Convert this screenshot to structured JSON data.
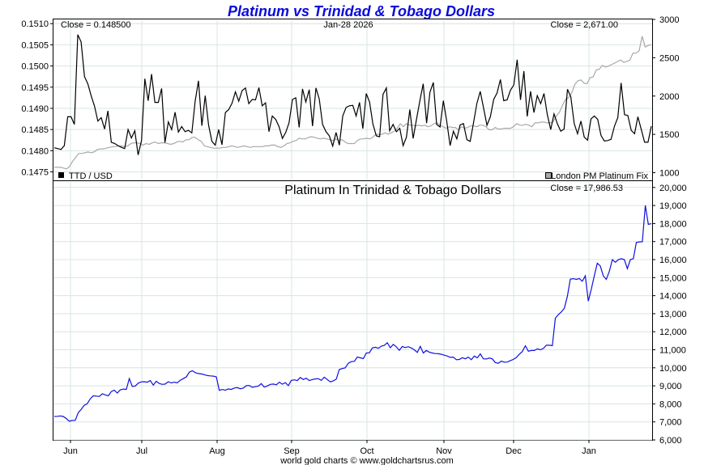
{
  "chart_data": {
    "type": "line",
    "title": "Platinum vs Trinidad & Tobago Dollars",
    "date": "Jan-28  2026",
    "footer": "world gold charts © www.goldchartsrus.com",
    "colors": {
      "title": "#0a0adc",
      "ttd": "#000000",
      "platinum_usd": "#a8a8a8",
      "platinum_ttd": "#1010e0",
      "grid": "#d8e4e4"
    },
    "x_ticks": [
      "Jun",
      "Jul",
      "Aug",
      "Sep",
      "Oct",
      "Nov",
      "Dec",
      "Jan"
    ],
    "top_panel": {
      "close_left": "Close = 0.148500",
      "close_right": "Close = 2,671.00",
      "left_ticks": [
        "0.1510",
        "0.1505",
        "0.1500",
        "0.1495",
        "0.1490",
        "0.1485",
        "0.1480",
        "0.1475"
      ],
      "right_ticks": [
        "3000",
        "2500",
        "2000",
        "1500",
        "1000"
      ],
      "ylim_left": [
        0.1473,
        0.1511
      ],
      "ylim_right": [
        900,
        3000
      ],
      "legend_left": "TTD / USD",
      "legend_right": "London PM Platinum Fix",
      "series": [
        {
          "name": "TTD / USD",
          "axis": "left",
          "values": [
            0.14807,
            0.14805,
            0.14803,
            0.14812,
            0.1488,
            0.1488,
            0.14862,
            0.15074,
            0.15057,
            0.14975,
            0.14958,
            0.1493,
            0.14905,
            0.1487,
            0.14878,
            0.14851,
            0.14894,
            0.1482,
            0.14817,
            0.14812,
            0.14808,
            0.14805,
            0.1485,
            0.1483,
            0.14847,
            0.1479,
            0.14824,
            0.1497,
            0.14918,
            0.14981,
            0.14914,
            0.14914,
            0.14947,
            0.14819,
            0.14868,
            0.1485,
            0.14891,
            0.14844,
            0.14857,
            0.14845,
            0.14848,
            0.14842,
            0.14917,
            0.14965,
            0.14859,
            0.1493,
            0.1486,
            0.14822,
            0.14813,
            0.1485,
            0.14814,
            0.1489,
            0.14897,
            0.14912,
            0.14939,
            0.14917,
            0.14942,
            0.14948,
            0.14911,
            0.14921,
            0.1492,
            0.14949,
            0.14906,
            0.14913,
            0.14845,
            0.14882,
            0.14874,
            0.14857,
            0.14829,
            0.14843,
            0.14866,
            0.14921,
            0.14925,
            0.14855,
            0.14946,
            0.14915,
            0.14944,
            0.14858,
            0.14948,
            0.14922,
            0.14862,
            0.14845,
            0.14835,
            0.14811,
            0.14843,
            0.14813,
            0.14882,
            0.14902,
            0.14906,
            0.14907,
            0.14882,
            0.14914,
            0.14852,
            0.14935,
            0.14915,
            0.14863,
            0.14835,
            0.14833,
            0.14933,
            0.14948,
            0.14847,
            0.14862,
            0.14845,
            0.14853,
            0.14812,
            0.14832,
            0.14897,
            0.14829,
            0.14875,
            0.14918,
            0.14958,
            0.14865,
            0.14938,
            0.14961,
            0.14862,
            0.14856,
            0.14918,
            0.1487,
            0.14812,
            0.14846,
            0.14828,
            0.14861,
            0.14864,
            0.14826,
            0.14822,
            0.14867,
            0.14912,
            0.1494,
            0.149,
            0.1486,
            0.1488,
            0.14921,
            0.14936,
            0.14968,
            0.14918,
            0.1492,
            0.14943,
            0.14955,
            0.15015,
            0.1492,
            0.14988,
            0.14881,
            0.1494,
            0.1489,
            0.1493,
            0.14911,
            0.14935,
            0.14885,
            0.1485,
            0.14887,
            0.14863,
            0.14846,
            0.14851,
            0.14945,
            0.14927,
            0.14864,
            0.1484,
            0.1487,
            0.14832,
            0.14825,
            0.14875,
            0.14882,
            0.14874,
            0.14836,
            0.14823,
            0.14824,
            0.14827,
            0.14858,
            0.14878,
            0.1496,
            0.14885,
            0.14883,
            0.14848,
            0.1484,
            0.1488,
            0.1485,
            0.1482,
            0.1482,
            0.14858
          ]
        },
        {
          "name": "London PM Platinum Fix",
          "axis": "right",
          "values": [
            1070,
            1070,
            1070,
            1060,
            1050,
            1080,
            1150,
            1200,
            1250,
            1250,
            1260,
            1270,
            1260,
            1270,
            1300,
            1310,
            1310,
            1320,
            1330,
            1340,
            1340,
            1350,
            1350,
            1340,
            1350,
            1380,
            1390,
            1390,
            1380,
            1360,
            1380,
            1370,
            1390,
            1400,
            1380,
            1390,
            1390,
            1380,
            1370,
            1380,
            1400,
            1410,
            1400,
            1430,
            1430,
            1460,
            1460,
            1430,
            1410,
            1350,
            1340,
            1330,
            1320,
            1320,
            1320,
            1330,
            1330,
            1340,
            1350,
            1340,
            1330,
            1340,
            1350,
            1340,
            1330,
            1340,
            1340,
            1340,
            1340,
            1350,
            1350,
            1360,
            1360,
            1340,
            1330,
            1350,
            1380,
            1390,
            1410,
            1420,
            1450,
            1440,
            1440,
            1460,
            1470,
            1460,
            1450,
            1440,
            1450,
            1440,
            1430,
            1420,
            1440,
            1420,
            1430,
            1400,
            1380,
            1380,
            1380,
            1420,
            1440,
            1440,
            1450,
            1440,
            1460,
            1500,
            1500,
            1500,
            1520,
            1500,
            1520,
            1540,
            1580,
            1640,
            1600,
            1640,
            1620,
            1620,
            1610,
            1620,
            1610,
            1620,
            1600,
            1610,
            1640,
            1650,
            1620,
            1600,
            1580,
            1600,
            1590,
            1590,
            1560,
            1600,
            1580,
            1590,
            1610,
            1610,
            1600,
            1620,
            1620,
            1600,
            1560,
            1560,
            1590,
            1570,
            1570,
            1580,
            1580,
            1580,
            1600,
            1640,
            1620,
            1620,
            1630,
            1620,
            1600,
            1650,
            1650,
            1660,
            1660,
            1650,
            1650,
            1670,
            1740,
            1790,
            1880,
            1960,
            1980,
            2040,
            2150,
            2200,
            2210,
            2170,
            2160,
            2240,
            2250,
            2340,
            2350,
            2400,
            2380,
            2390,
            2410,
            2430,
            2450,
            2470,
            2440,
            2450,
            2470,
            2560,
            2560,
            2590,
            2780,
            2640,
            2660,
            2671
          ]
        }
      ]
    },
    "bottom_panel": {
      "title": "Platinum In Trinidad & Tobago Dollars",
      "close": "Close = 17,986.53",
      "right_ticks": [
        "20,000",
        "19,000",
        "18,000",
        "17,000",
        "16,000",
        "15,000",
        "14,000",
        "13,000",
        "12,000",
        "11,000",
        "10,000",
        "9,000",
        "8,000",
        "7,000",
        "6,000"
      ],
      "ylim": [
        6000,
        20350
      ],
      "series": [
        {
          "name": "Platinum In Trinidad & Tobago Dollars",
          "values": [
            7300,
            7310,
            7330,
            7300,
            7190,
            7040,
            7080,
            7090,
            7510,
            7700,
            7920,
            8010,
            8280,
            8450,
            8430,
            8410,
            8560,
            8500,
            8450,
            8680,
            8760,
            8600,
            8780,
            8820,
            8800,
            9400,
            8970,
            8990,
            9150,
            9220,
            9230,
            9200,
            9290,
            9040,
            9250,
            9130,
            9080,
            9100,
            9230,
            9160,
            9200,
            9170,
            9310,
            9400,
            9500,
            9760,
            9840,
            9730,
            9680,
            9660,
            9620,
            9570,
            9550,
            9540,
            9500,
            8750,
            8800,
            8760,
            8830,
            8800,
            8880,
            8900,
            8840,
            8870,
            9010,
            9020,
            8920,
            8950,
            8980,
            9120,
            8930,
            8990,
            9080,
            9100,
            9060,
            9200,
            9090,
            9180,
            9010,
            9300,
            9330,
            9290,
            9460,
            9350,
            9420,
            9290,
            9350,
            9380,
            9400,
            9300,
            9480,
            9350,
            9220,
            9280,
            9370,
            9900,
            9960,
            10000,
            10250,
            10340,
            10360,
            10600,
            10550,
            10510,
            10820,
            10830,
            11100,
            11140,
            11080,
            11200,
            11240,
            11390,
            11110,
            11300,
            11160,
            10970,
            11180,
            11120,
            11170,
            11100,
            11000,
            10850,
            11190,
            10820,
            10960,
            10870,
            10820,
            10790,
            10780,
            10750,
            10700,
            10650,
            10580,
            10590,
            10450,
            10460,
            10560,
            10500,
            10590,
            10450,
            10650,
            10550,
            10770,
            10500,
            10490,
            10540,
            10500,
            10290,
            10250,
            10370,
            10310,
            10320,
            10400,
            10460,
            10570,
            10750,
            10900,
            11220,
            10920,
            10960,
            10960,
            11050,
            11000,
            11070,
            11250,
            11250,
            11230,
            12750,
            12950,
            13100,
            13300,
            13950,
            14920,
            14940,
            14900,
            14950,
            14800,
            15100,
            13700,
            14360,
            15100,
            15800,
            15650,
            15100,
            14900,
            15350,
            16000,
            15850,
            16000,
            16050,
            16000,
            15500,
            16000,
            16050,
            16950,
            16980,
            16990,
            19000,
            17950,
            17990
          ]
        }
      ]
    }
  }
}
